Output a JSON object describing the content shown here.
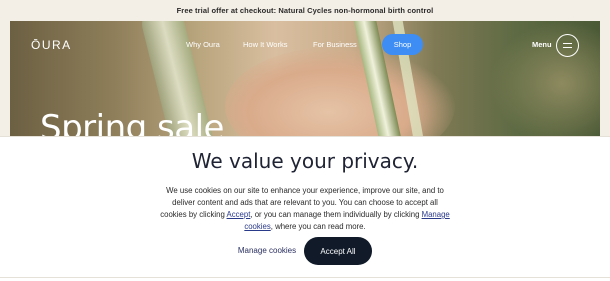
{
  "promo": {
    "text": "Free trial offer at checkout: Natural Cycles non-hormonal birth control"
  },
  "nav": {
    "logo": "ŌURA",
    "links": [
      "Why Oura",
      "How It Works",
      "For Business"
    ],
    "shop_label": "Shop",
    "menu_label": "Menu"
  },
  "hero": {
    "title": "Spring sale"
  },
  "privacy": {
    "title": "We value your privacy.",
    "body_before": "We use cookies on our site to enhance your experience, improve our site, and to deliver content and ads that are relevant to you. You can choose to accept all cookies by clicking ",
    "accept_link": "Accept",
    "body_middle": ", or you can manage them individually by clicking ",
    "manage_link": "Manage cookies",
    "body_after": ", where you can read more.",
    "manage_button": "Manage cookies",
    "accept_button": "Accept All"
  },
  "colors": {
    "shop_button": "#3d8df5",
    "accept_button": "#101a29",
    "background": "#f4efe6"
  }
}
